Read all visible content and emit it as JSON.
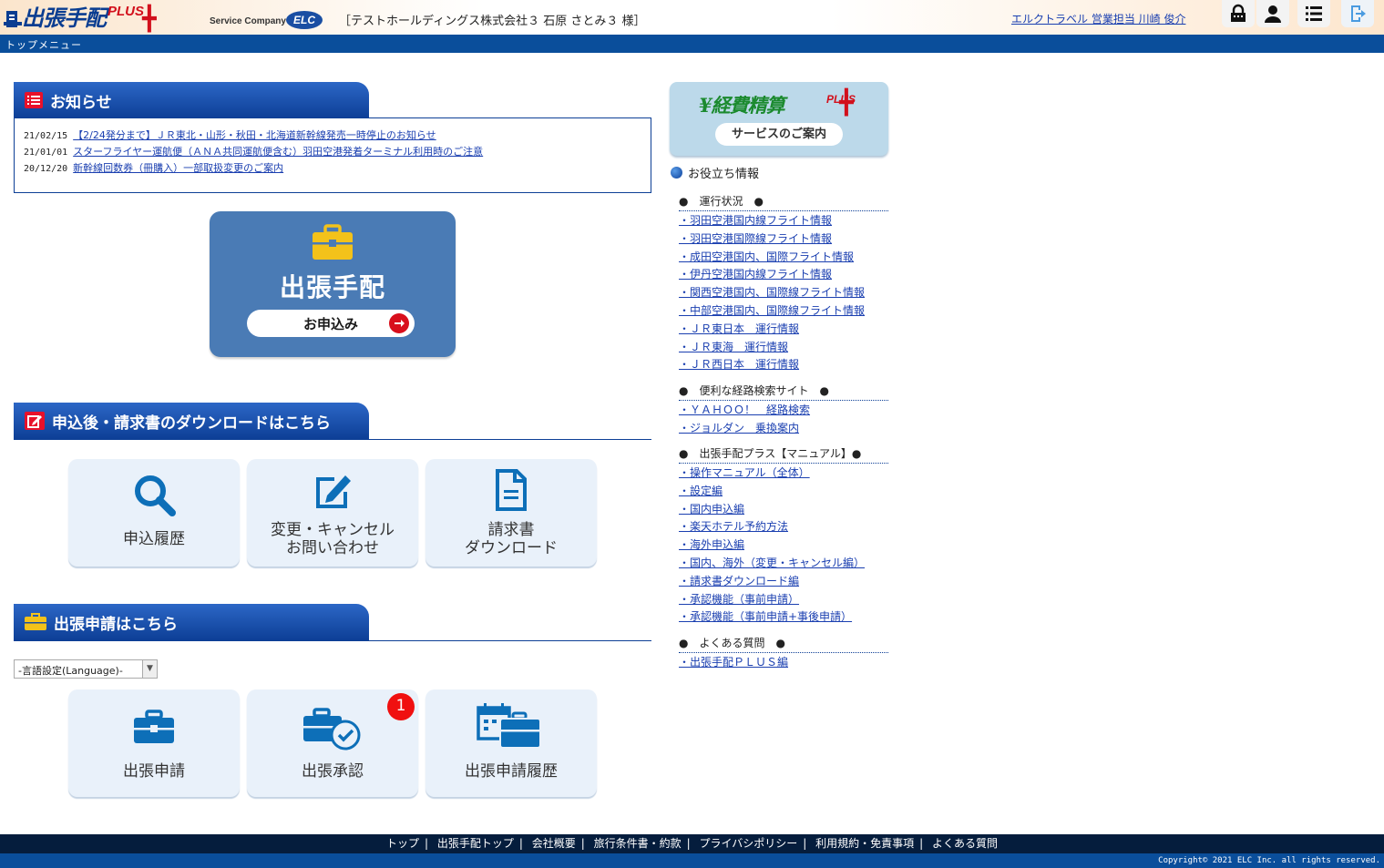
{
  "header": {
    "brand": "出張手配",
    "brand_plus": "PLUS",
    "service_company": "Service Company",
    "elc": "ELC",
    "company": "［テストホールディングス株式会社３ 石原 さとみ３ 様］",
    "agent": "エルクトラベル 営業担当 川崎 俊介",
    "icons": [
      "lock-icon",
      "user-icon",
      "list-icon",
      "logout-icon"
    ]
  },
  "breadcrumb": "トップメニュー",
  "news": {
    "title": "お知らせ",
    "items": [
      {
        "date": "21/02/15",
        "text": "【2/24発分まで】ＪＲ東北・山形・秋田・北海道新幹線発売一時停止のお知らせ"
      },
      {
        "date": "21/01/01",
        "text": "スターフライヤー運航便（ＡＮＡ共同運航便含む）羽田空港発着ターミナル利用時のご注意"
      },
      {
        "date": "20/12/20",
        "text": "新幹線回数券（冊購入）一部取扱変更のご案内"
      }
    ]
  },
  "big_button": {
    "title": "出張手配",
    "pill": "お申込み"
  },
  "download_section": {
    "title": "申込後・請求書のダウンロードはこちら",
    "tiles": [
      {
        "line1": "申込履歴",
        "line2": ""
      },
      {
        "line1": "変更・キャンセル",
        "line2": "お問い合わせ"
      },
      {
        "line1": "請求書",
        "line2": "ダウンロード"
      }
    ]
  },
  "apply_section": {
    "title": "出張申請はこちら",
    "language_select": "-言語設定(Language)-",
    "badge": "1",
    "tiles": [
      {
        "label": "出張申請"
      },
      {
        "label": "出張承認"
      },
      {
        "label": "出張申請履歴"
      }
    ]
  },
  "keihi": {
    "title": "経費精算",
    "plus": "PLUS",
    "button": "サービスのご案内"
  },
  "useful": {
    "title": "お役立ち情報",
    "groups": [
      {
        "heading": "●　運行状況　●",
        "links": [
          "・羽田空港国内線フライト情報",
          "・羽田空港国際線フライト情報",
          "・成田空港国内、国際フライト情報",
          "・伊丹空港国内線フライト情報",
          "・関西空港国内、国際線フライト情報",
          "・中部空港国内、国際線フライト情報",
          "・ＪＲ東日本　運行情報",
          "・ＪＲ東海　運行情報",
          "・ＪＲ西日本　運行情報"
        ]
      },
      {
        "heading": "●　便利な経路検索サイト　●",
        "links": [
          "・ＹＡＨＯＯ！　経路検索",
          "・ジョルダン　乗換案内"
        ]
      },
      {
        "heading": "●　出張手配プラス【マニュアル】●",
        "links": [
          "・操作マニュアル（全体）",
          "・設定編",
          "・国内申込編",
          "・楽天ホテル予約方法",
          "・海外申込編",
          "・国内、海外（変更・キャンセル編）",
          "・請求書ダウンロード編",
          "・承認機能（事前申請）",
          "・承認機能（事前申請+事後申請）"
        ]
      },
      {
        "heading": "●　よくある質問　●",
        "links": [
          "・出張手配ＰＬＵＳ編"
        ]
      }
    ]
  },
  "footer": {
    "links": [
      "トップ",
      "出張手配トップ",
      "会社概要",
      "旅行条件書・約款",
      "プライバシポリシー",
      "利用規約・免責事項",
      "よくある質問"
    ],
    "copyright": "Copyright© 2021 ELC Inc. all rights reserved."
  },
  "colors": {
    "navy": "#0a4e9b",
    "header_tab": "#0d3f96",
    "tile_bg": "#e9f1fa",
    "icon_blue": "#0d6fb8",
    "accent_red": "#d80f1c"
  }
}
